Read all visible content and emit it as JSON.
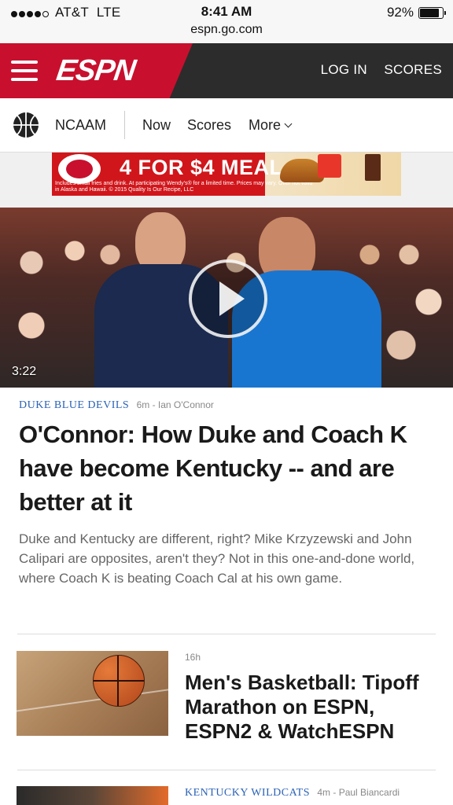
{
  "status_bar": {
    "carrier": "AT&T",
    "network": "LTE",
    "time": "8:41 AM",
    "battery": "92%",
    "battery_level": 0.92,
    "url": "espn.go.com"
  },
  "header": {
    "logo": "ESPN",
    "login_label": "LOG IN",
    "scores_label": "SCORES",
    "brand_red": "#c8102e"
  },
  "subnav": {
    "sport": "NCAAM",
    "links": [
      "Now",
      "Scores",
      "More"
    ]
  },
  "ad": {
    "brand": "Wendy's",
    "headline": "4 FOR $4 MEAL",
    "fine_print": "Includes small fries and drink. At participating Wendy's® for a limited time. Prices may vary. Offer not valid in Alaska and Hawaii. © 2015 Quality Is Our Recipe, LLC"
  },
  "top_story": {
    "video_duration": "3:22",
    "category": "DUKE BLUE DEVILS",
    "age": "6m",
    "author": "Ian O'Connor",
    "headline": "O'Connor: How Duke and Coach K have become Kentucky -- and are better at it",
    "summary": "Duke and Kentucky are different, right? Mike Krzyzewski and John Calipari are opposites, aren't they? Not in this one-and-done world, where Coach K is beating Coach Cal at his own game."
  },
  "story2": {
    "age": "16h",
    "headline": "Men's Basketball: Tipoff Marathon on ESPN, ESPN2 & WatchESPN"
  },
  "story3": {
    "category": "KENTUCKY WILDCATS",
    "age": "4m",
    "author": "Paul Biancardi"
  },
  "colors": {
    "category_blue": "#2a62b6",
    "topbar_dark": "#2c2c2c"
  }
}
